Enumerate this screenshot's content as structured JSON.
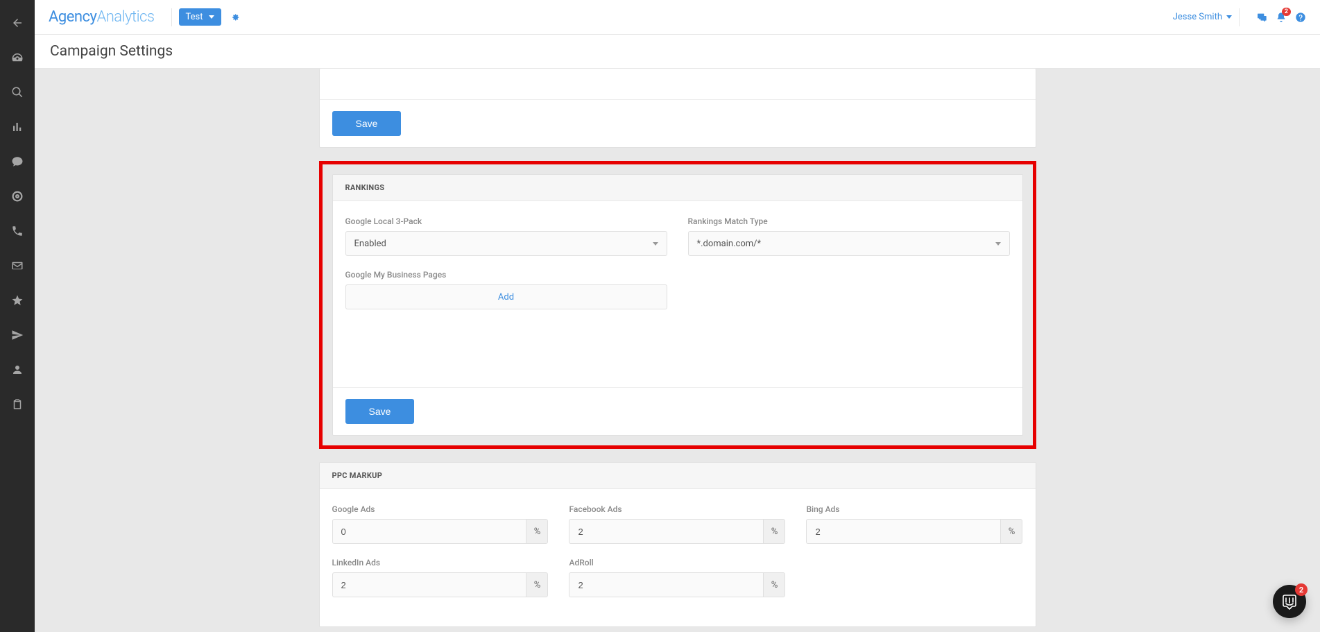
{
  "brand": {
    "part1": "Agency",
    "part2": "Analytics"
  },
  "campaign_dropdown": {
    "label": "Test"
  },
  "user": {
    "name": "Jesse Smith"
  },
  "notifications": {
    "count": "2"
  },
  "page_title": "Campaign Settings",
  "panels": {
    "first": {
      "save_label": "Save"
    },
    "rankings": {
      "title": "Rankings",
      "save_label": "Save",
      "fields": {
        "local3pack": {
          "label": "Google Local 3-Pack",
          "value": "Enabled"
        },
        "matchtype": {
          "label": "Rankings Match Type",
          "value": "*.domain.com/*"
        },
        "gmypages": {
          "label": "Google My Business Pages",
          "add_label": "Add"
        }
      }
    },
    "ppc": {
      "title": "PPC Markup",
      "fields": {
        "google_ads": {
          "label": "Google Ads",
          "value": "0",
          "suffix": "%"
        },
        "facebook_ads": {
          "label": "Facebook Ads",
          "value": "2",
          "suffix": "%"
        },
        "bing_ads": {
          "label": "Bing Ads",
          "value": "2",
          "suffix": "%"
        },
        "linkedin_ads": {
          "label": "LinkedIn Ads",
          "value": "2",
          "suffix": "%"
        },
        "adroll": {
          "label": "AdRoll",
          "value": "2",
          "suffix": "%"
        }
      }
    }
  },
  "intercom": {
    "count": "2"
  }
}
